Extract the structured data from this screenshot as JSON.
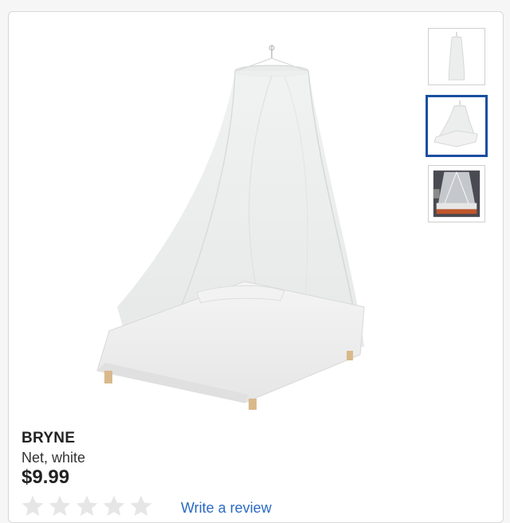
{
  "product": {
    "name": "BRYNE",
    "description": "Net, white",
    "price": "$9.99"
  },
  "gallery": {
    "main_image": "bed-with-canopy-net",
    "thumbnails": [
      {
        "name": "canopy-net-only",
        "selected": false
      },
      {
        "name": "canopy-net-over-bed",
        "selected": true
      },
      {
        "name": "canopy-net-room-photo",
        "selected": false
      }
    ]
  },
  "review": {
    "rating": 0,
    "max_rating": 5,
    "write_review_label": "Write a review"
  },
  "colors": {
    "selected_border": "#1a4fa0",
    "link": "#2a6ac4",
    "star_empty": "#e6e6e6"
  }
}
